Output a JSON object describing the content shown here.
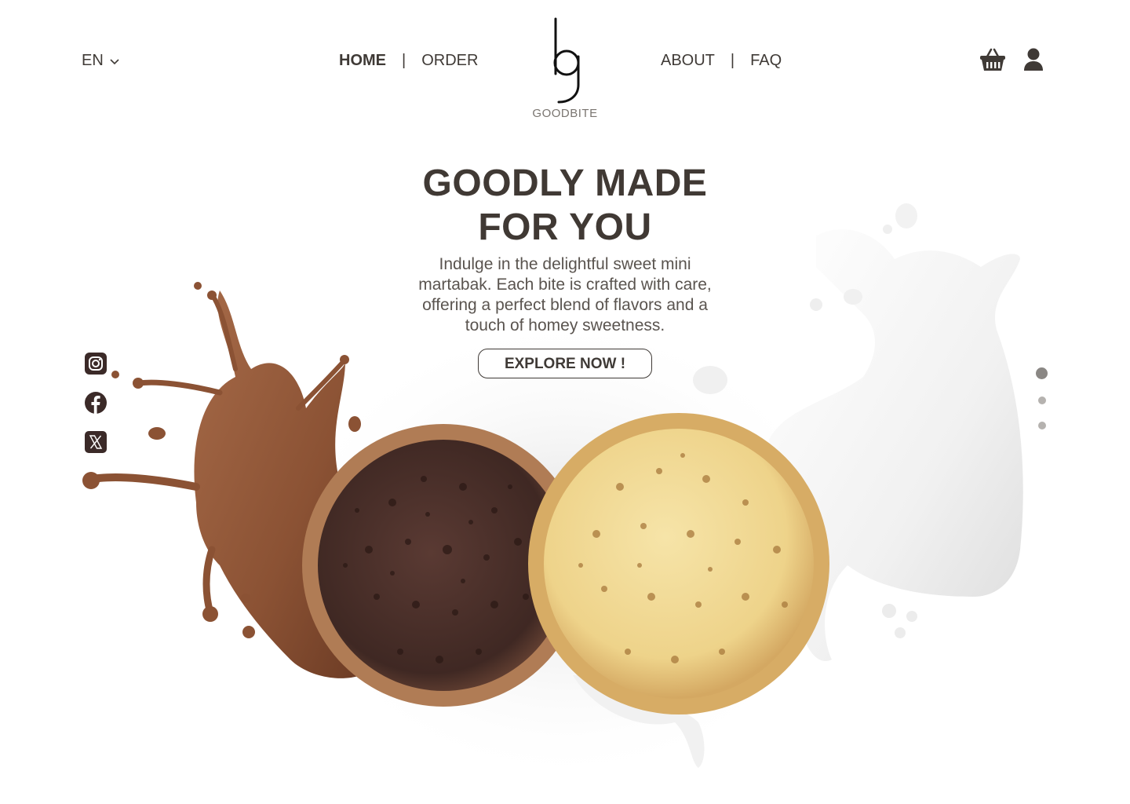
{
  "language": {
    "current": "EN"
  },
  "nav": {
    "left": [
      {
        "label": "HOME",
        "active": true
      },
      {
        "label": "ORDER",
        "active": false
      }
    ],
    "right": [
      {
        "label": "ABOUT",
        "active": false
      },
      {
        "label": "FAQ",
        "active": false
      }
    ],
    "separator": "|"
  },
  "logo": {
    "brand": "GOODBITE",
    "monogram": "bg"
  },
  "header_icons": [
    "basket-icon",
    "user-icon"
  ],
  "hero": {
    "title_line1": "GOODLY MADE",
    "title_line2": "FOR YOU",
    "description": "Indulge in the delightful sweet mini martabak. Each bite is crafted with care, offering a perfect blend of flavors and a touch of homey sweetness.",
    "cta": "EXPLORE NOW !"
  },
  "social": [
    "instagram-icon",
    "facebook-icon",
    "x-icon"
  ],
  "carousel": {
    "slides": 3,
    "active_index": 0
  },
  "colors": {
    "text": "#3f3a36",
    "chocolate": "#8a5236",
    "milk": "#f4f4f4",
    "cake_dark": "#4a2f2a",
    "cake_light": "#f0d890"
  }
}
